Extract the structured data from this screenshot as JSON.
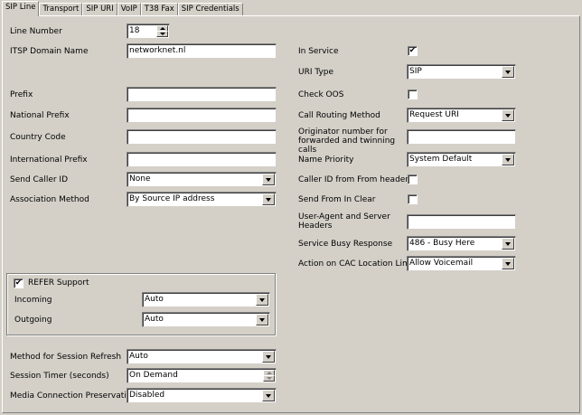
{
  "tabs": [
    "SIP Line",
    "Transport",
    "SIP URI",
    "VoIP",
    "T38 Fax",
    "SIP Credentials"
  ],
  "left": {
    "line_number": {
      "label": "Line Number",
      "value": "18"
    },
    "itsp_domain": {
      "label": "ITSP Domain Name",
      "value": "networknet.nl"
    },
    "prefix": {
      "label": "Prefix",
      "value": ""
    },
    "national_prefix": {
      "label": "National Prefix",
      "value": ""
    },
    "country_code": {
      "label": "Country Code",
      "value": ""
    },
    "international_prefix": {
      "label": "International Prefix",
      "value": ""
    },
    "send_caller_id": {
      "label": "Send Caller ID",
      "value": "None"
    },
    "association_method": {
      "label": "Association Method",
      "value": "By Source IP address"
    }
  },
  "refer": {
    "label": "REFER Support",
    "checked": "✔",
    "incoming": {
      "label": "Incoming",
      "value": "Auto"
    },
    "outgoing": {
      "label": "Outgoing",
      "value": "Auto"
    }
  },
  "session": {
    "refresh": {
      "label": "Method for Session Refresh",
      "value": "Auto"
    },
    "timer": {
      "label": "Session Timer (seconds)",
      "value": "On Demand"
    },
    "media": {
      "label": "Media Connection Preservation",
      "value": "Disabled"
    }
  },
  "right": {
    "in_service": {
      "label": "In Service",
      "checked": "✔"
    },
    "uri_type": {
      "label": "URI Type",
      "value": "SIP"
    },
    "check_oos": {
      "label": "Check OOS",
      "checked": ""
    },
    "call_routing": {
      "label": "Call Routing Method",
      "value": "Request URI"
    },
    "originator": {
      "label": "Originator number for forwarded and twinning calls",
      "value": ""
    },
    "name_priority": {
      "label": "Name Priority",
      "value": "System Default"
    },
    "caller_id_from": {
      "label": "Caller ID from From header",
      "checked": ""
    },
    "send_from_clear": {
      "label": "Send From In Clear",
      "checked": ""
    },
    "user_agent": {
      "label": "User-Agent and Server Headers",
      "value": ""
    },
    "service_busy": {
      "label": "Service Busy Response",
      "value": "486 - Busy Here"
    },
    "cac_action": {
      "label": "Action on CAC Location Limit",
      "value": "Allow Voicemail"
    }
  }
}
